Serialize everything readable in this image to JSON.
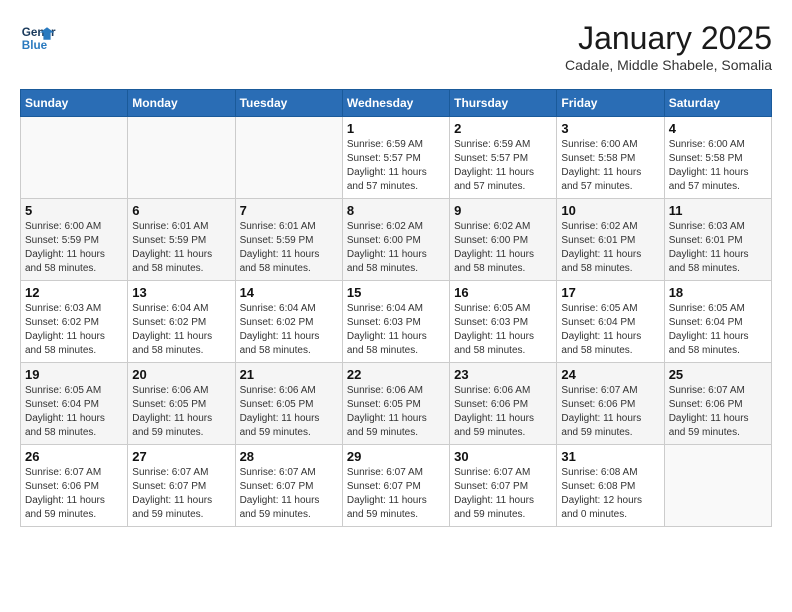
{
  "header": {
    "logo_line1": "General",
    "logo_line2": "Blue",
    "month": "January 2025",
    "location": "Cadale, Middle Shabele, Somalia"
  },
  "weekdays": [
    "Sunday",
    "Monday",
    "Tuesday",
    "Wednesday",
    "Thursday",
    "Friday",
    "Saturday"
  ],
  "weeks": [
    [
      {
        "day": "",
        "sunrise": "",
        "sunset": "",
        "daylight": ""
      },
      {
        "day": "",
        "sunrise": "",
        "sunset": "",
        "daylight": ""
      },
      {
        "day": "",
        "sunrise": "",
        "sunset": "",
        "daylight": ""
      },
      {
        "day": "1",
        "sunrise": "6:59 AM",
        "sunset": "5:57 PM",
        "daylight": "Daylight: 11 hours and 57 minutes."
      },
      {
        "day": "2",
        "sunrise": "6:59 AM",
        "sunset": "5:57 PM",
        "daylight": "Daylight: 11 hours and 57 minutes."
      },
      {
        "day": "3",
        "sunrise": "6:00 AM",
        "sunset": "5:58 PM",
        "daylight": "Daylight: 11 hours and 57 minutes."
      },
      {
        "day": "4",
        "sunrise": "6:00 AM",
        "sunset": "5:58 PM",
        "daylight": "Daylight: 11 hours and 57 minutes."
      }
    ],
    [
      {
        "day": "5",
        "sunrise": "6:00 AM",
        "sunset": "5:59 PM",
        "daylight": "Daylight: 11 hours and 58 minutes."
      },
      {
        "day": "6",
        "sunrise": "6:01 AM",
        "sunset": "5:59 PM",
        "daylight": "Daylight: 11 hours and 58 minutes."
      },
      {
        "day": "7",
        "sunrise": "6:01 AM",
        "sunset": "5:59 PM",
        "daylight": "Daylight: 11 hours and 58 minutes."
      },
      {
        "day": "8",
        "sunrise": "6:02 AM",
        "sunset": "6:00 PM",
        "daylight": "Daylight: 11 hours and 58 minutes."
      },
      {
        "day": "9",
        "sunrise": "6:02 AM",
        "sunset": "6:00 PM",
        "daylight": "Daylight: 11 hours and 58 minutes."
      },
      {
        "day": "10",
        "sunrise": "6:02 AM",
        "sunset": "6:01 PM",
        "daylight": "Daylight: 11 hours and 58 minutes."
      },
      {
        "day": "11",
        "sunrise": "6:03 AM",
        "sunset": "6:01 PM",
        "daylight": "Daylight: 11 hours and 58 minutes."
      }
    ],
    [
      {
        "day": "12",
        "sunrise": "6:03 AM",
        "sunset": "6:02 PM",
        "daylight": "Daylight: 11 hours and 58 minutes."
      },
      {
        "day": "13",
        "sunrise": "6:04 AM",
        "sunset": "6:02 PM",
        "daylight": "Daylight: 11 hours and 58 minutes."
      },
      {
        "day": "14",
        "sunrise": "6:04 AM",
        "sunset": "6:02 PM",
        "daylight": "Daylight: 11 hours and 58 minutes."
      },
      {
        "day": "15",
        "sunrise": "6:04 AM",
        "sunset": "6:03 PM",
        "daylight": "Daylight: 11 hours and 58 minutes."
      },
      {
        "day": "16",
        "sunrise": "6:05 AM",
        "sunset": "6:03 PM",
        "daylight": "Daylight: 11 hours and 58 minutes."
      },
      {
        "day": "17",
        "sunrise": "6:05 AM",
        "sunset": "6:04 PM",
        "daylight": "Daylight: 11 hours and 58 minutes."
      },
      {
        "day": "18",
        "sunrise": "6:05 AM",
        "sunset": "6:04 PM",
        "daylight": "Daylight: 11 hours and 58 minutes."
      }
    ],
    [
      {
        "day": "19",
        "sunrise": "6:05 AM",
        "sunset": "6:04 PM",
        "daylight": "Daylight: 11 hours and 58 minutes."
      },
      {
        "day": "20",
        "sunrise": "6:06 AM",
        "sunset": "6:05 PM",
        "daylight": "Daylight: 11 hours and 59 minutes."
      },
      {
        "day": "21",
        "sunrise": "6:06 AM",
        "sunset": "6:05 PM",
        "daylight": "Daylight: 11 hours and 59 minutes."
      },
      {
        "day": "22",
        "sunrise": "6:06 AM",
        "sunset": "6:05 PM",
        "daylight": "Daylight: 11 hours and 59 minutes."
      },
      {
        "day": "23",
        "sunrise": "6:06 AM",
        "sunset": "6:06 PM",
        "daylight": "Daylight: 11 hours and 59 minutes."
      },
      {
        "day": "24",
        "sunrise": "6:07 AM",
        "sunset": "6:06 PM",
        "daylight": "Daylight: 11 hours and 59 minutes."
      },
      {
        "day": "25",
        "sunrise": "6:07 AM",
        "sunset": "6:06 PM",
        "daylight": "Daylight: 11 hours and 59 minutes."
      }
    ],
    [
      {
        "day": "26",
        "sunrise": "6:07 AM",
        "sunset": "6:06 PM",
        "daylight": "Daylight: 11 hours and 59 minutes."
      },
      {
        "day": "27",
        "sunrise": "6:07 AM",
        "sunset": "6:07 PM",
        "daylight": "Daylight: 11 hours and 59 minutes."
      },
      {
        "day": "28",
        "sunrise": "6:07 AM",
        "sunset": "6:07 PM",
        "daylight": "Daylight: 11 hours and 59 minutes."
      },
      {
        "day": "29",
        "sunrise": "6:07 AM",
        "sunset": "6:07 PM",
        "daylight": "Daylight: 11 hours and 59 minutes."
      },
      {
        "day": "30",
        "sunrise": "6:07 AM",
        "sunset": "6:07 PM",
        "daylight": "Daylight: 11 hours and 59 minutes."
      },
      {
        "day": "31",
        "sunrise": "6:08 AM",
        "sunset": "6:08 PM",
        "daylight": "Daylight: 12 hours and 0 minutes."
      },
      {
        "day": "",
        "sunrise": "",
        "sunset": "",
        "daylight": ""
      }
    ]
  ],
  "labels": {
    "sunrise_prefix": "Sunrise: ",
    "sunset_prefix": "Sunset: "
  }
}
